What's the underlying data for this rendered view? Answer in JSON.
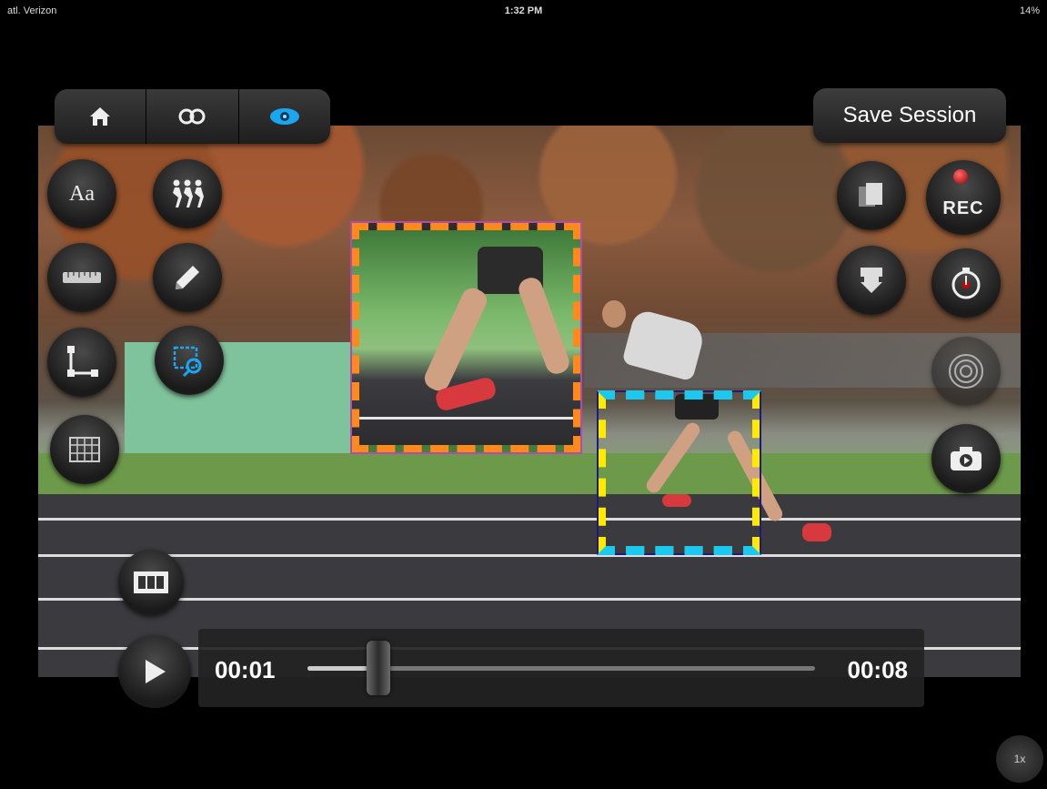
{
  "status_bar": {
    "carrier": "atl. Verizon",
    "time": "1:32 PM",
    "battery": "14%"
  },
  "top_toolbar": {
    "items": [
      {
        "icon": "home-icon",
        "glyph": "⌂"
      },
      {
        "icon": "link-icon",
        "glyph": "∞"
      },
      {
        "icon": "eye-icon",
        "glyph": "◉",
        "active": true
      }
    ]
  },
  "save_button": {
    "label": "Save Session"
  },
  "left_tools": [
    {
      "name": "text-tool",
      "label": "Aa"
    },
    {
      "name": "motion-tool"
    },
    {
      "name": "ruler-tool"
    },
    {
      "name": "pencil-tool"
    },
    {
      "name": "angle-tool"
    },
    {
      "name": "zoom-tool"
    },
    {
      "name": "grid-tool"
    }
  ],
  "right_tools": {
    "rec_label": "REC",
    "items": [
      "copy",
      "download",
      "timer",
      "target",
      "camera"
    ]
  },
  "playback": {
    "current_time": "00:01",
    "end_time": "00:08",
    "progress": 0.14,
    "speed": "1x"
  },
  "colors": {
    "accent_blue": "#1aa6f0",
    "zoom_big_border": "#ff8a1a",
    "zoom_small_border": "#ffea00",
    "zoom_small_dash": "#1ac8f0",
    "rec_red": "#d00000"
  }
}
